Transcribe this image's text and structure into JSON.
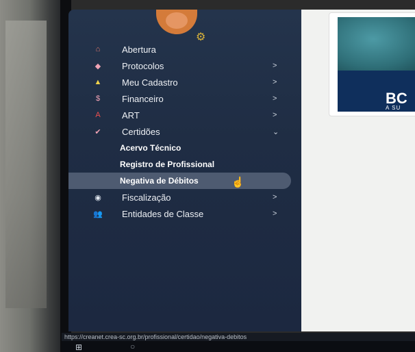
{
  "sidebar": {
    "items": [
      {
        "label": "Abertura",
        "icon": "home-icon",
        "glyph": "⌂",
        "chevron": ""
      },
      {
        "label": "Protocolos",
        "icon": "layers-icon",
        "glyph": "◆",
        "chevron": ">"
      },
      {
        "label": "Meu Cadastro",
        "icon": "user-icon",
        "glyph": "▲",
        "chevron": ">"
      },
      {
        "label": "Financeiro",
        "icon": "dollar-icon",
        "glyph": "$",
        "chevron": ">"
      },
      {
        "label": "ART",
        "icon": "art-icon",
        "glyph": "A",
        "chevron": ">"
      },
      {
        "label": "Certidões",
        "icon": "certificate-icon",
        "glyph": "✔",
        "chevron": "⌄"
      }
    ],
    "subitems": [
      {
        "label": "Acervo Técnico"
      },
      {
        "label": "Registro de Profissional"
      },
      {
        "label": "Negativa de Débitos"
      }
    ],
    "items_after": [
      {
        "label": "Fiscalização",
        "icon": "inspection-icon",
        "glyph": "◉",
        "chevron": ">"
      },
      {
        "label": "Entidades de Classe",
        "icon": "group-icon",
        "glyph": "👥",
        "chevron": ">"
      }
    ]
  },
  "banner": {
    "text1": "BC",
    "text2": "A SU"
  },
  "statusbar": {
    "url": "https://creanet.crea-sc.org.br/profissional/certidao/negativa-debitos"
  },
  "colors": {
    "sidebar": "#1f2d44",
    "accent": "#d9b23a",
    "active_item": "#8c96aa"
  }
}
